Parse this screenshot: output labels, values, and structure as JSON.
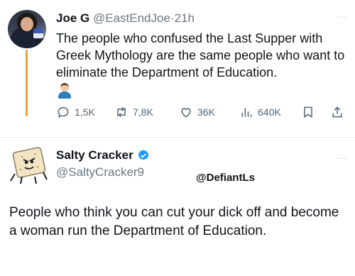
{
  "tweet1": {
    "name": "Joe G",
    "handle": "@EastEndJoe",
    "separator": "·",
    "time": "21h",
    "text": "The people who confused the Last Supper with Greek Mythology are the same people who want to eliminate the Department of Education.",
    "actions": {
      "replies": "1,5K",
      "reposts": "7,8K",
      "likes": "36K",
      "views": "640K"
    },
    "more": "···"
  },
  "tweet2": {
    "name": "Salty Cracker",
    "handle": "@SaltyCracker9",
    "watermark": "@DefiantLs",
    "text": "People who think you can cut your dick off and become a woman run the Department of Education.",
    "more": "···"
  },
  "colors": {
    "text": "#0f1419",
    "secondary": "#536471",
    "verified": "#1d9bf0",
    "thread_line": "#f0a035"
  },
  "icons": [
    "reply-icon",
    "repost-icon",
    "like-icon",
    "views-icon",
    "bookmark-icon",
    "share-icon",
    "verified-badge-icon",
    "more-icon"
  ]
}
